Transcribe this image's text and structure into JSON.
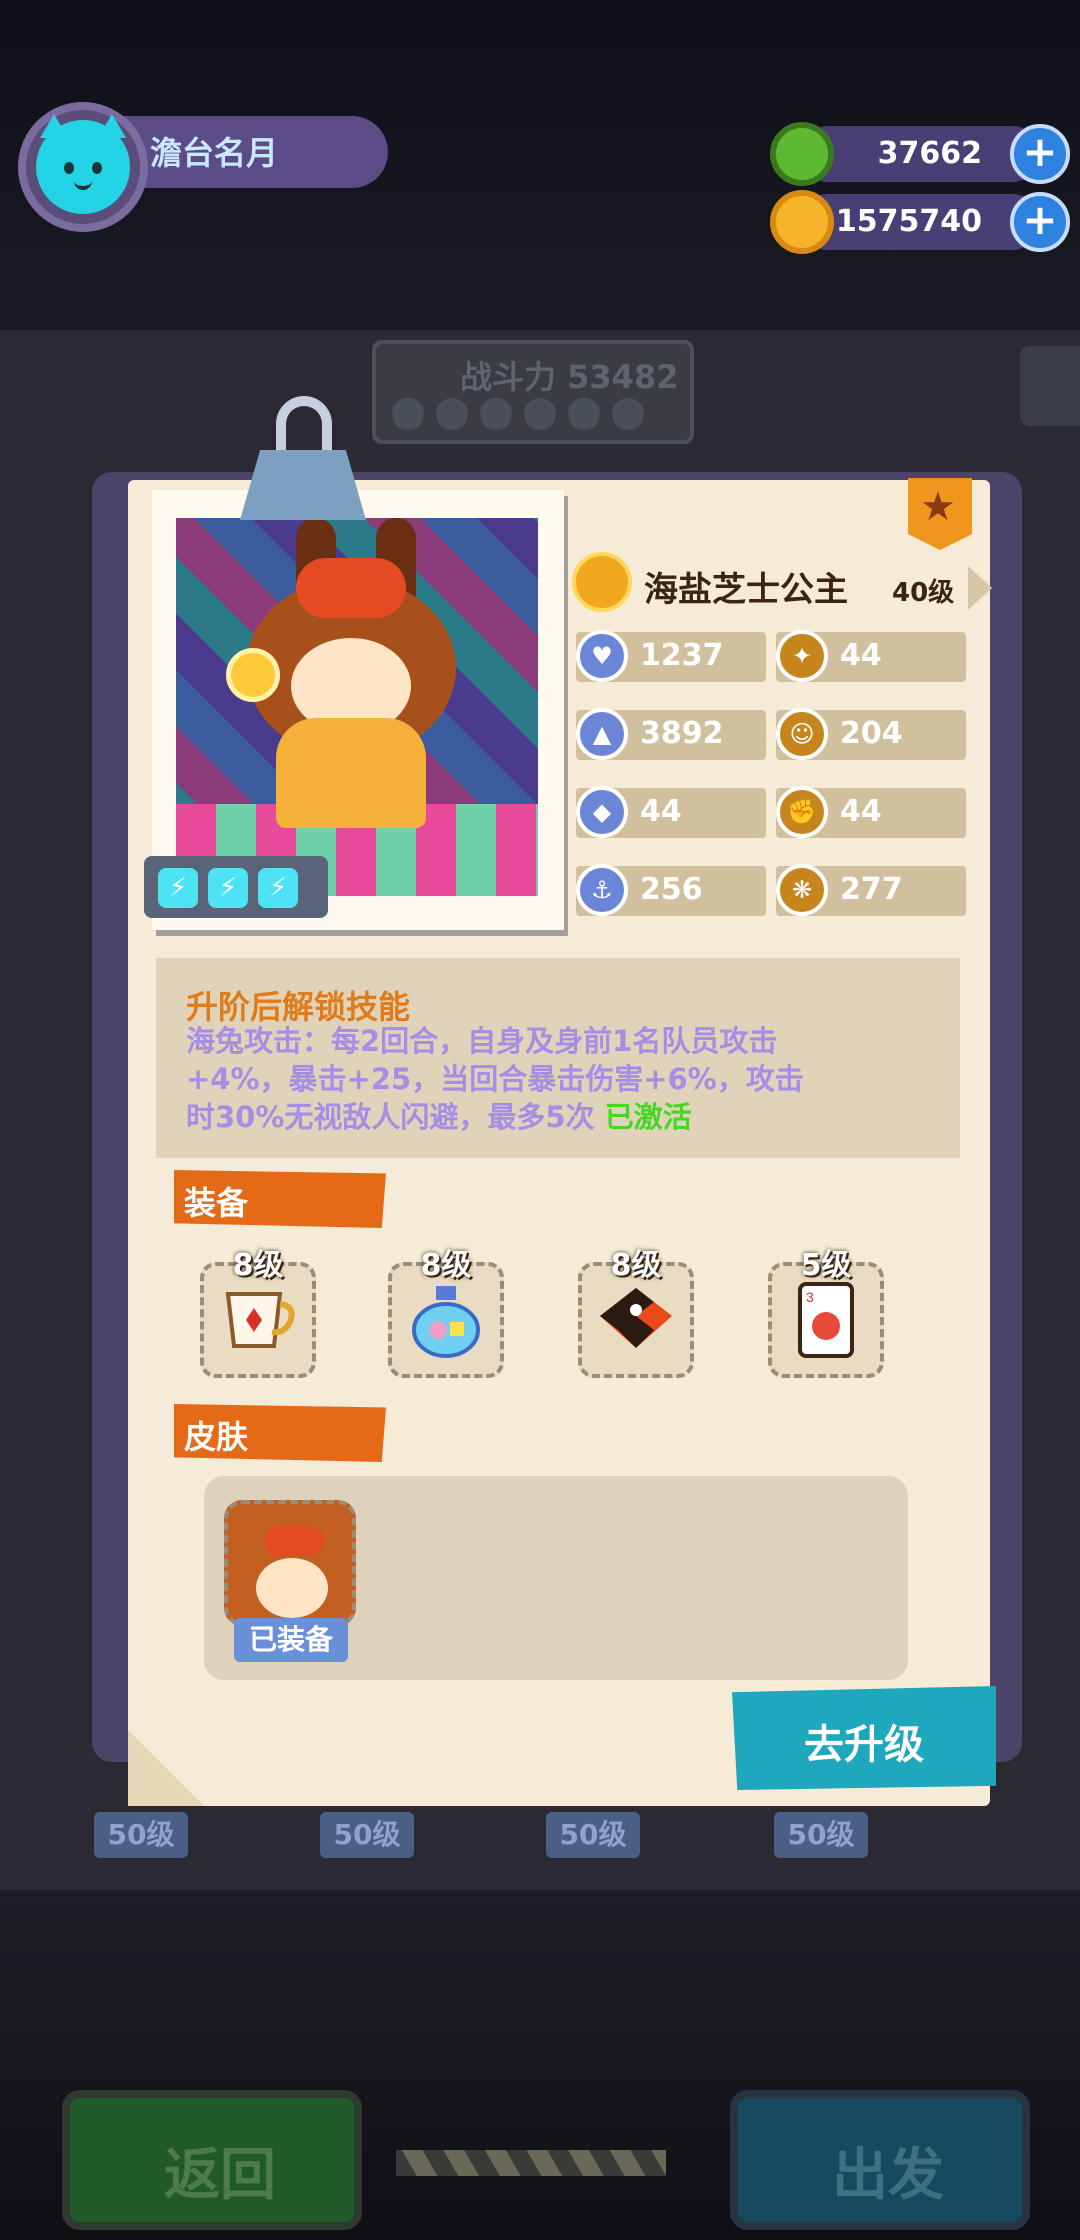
{
  "header": {
    "player_name": "澹台名月",
    "resources": [
      {
        "icon": "green-gem-coin-icon",
        "value": "37662"
      },
      {
        "icon": "gold-planet-coin-icon",
        "value": "1575740"
      }
    ],
    "plus_icon": "plus-icon"
  },
  "background": {
    "power_label": "战斗力 53482",
    "level_badges": [
      "50级",
      "50级",
      "50级",
      "50级"
    ]
  },
  "card": {
    "character_name": "海盐芝士公主",
    "level": "40级",
    "stats": [
      {
        "icon": "heart-shield-icon",
        "value": "1237"
      },
      {
        "icon": "crit-icon",
        "value": "44"
      },
      {
        "icon": "attack-icon",
        "value": "3892"
      },
      {
        "icon": "smile-icon",
        "value": "204"
      },
      {
        "icon": "defense-shield-icon",
        "value": "44"
      },
      {
        "icon": "muscle-icon",
        "value": "44"
      },
      {
        "icon": "anchor-icon",
        "value": "256"
      },
      {
        "icon": "dodge-icon",
        "value": "277"
      }
    ],
    "skill": {
      "title": "升阶后解锁技能",
      "description": "海兔攻击：每2回合，自身及身前1名队员攻击+4%，暴击+25，当回合暴击伤害+6%，攻击时30%无视敌人闪避，最多5次",
      "status": "已激活"
    },
    "equipment": {
      "title": "装备",
      "items": [
        {
          "icon": "teacup-icon",
          "level": "8级"
        },
        {
          "icon": "bottle-icon",
          "level": "8级"
        },
        {
          "icon": "checkerboard-icon",
          "level": "8级"
        },
        {
          "icon": "playing-card-icon",
          "level": "5级"
        }
      ]
    },
    "skin": {
      "title": "皮肤",
      "equipped_label": "已装备"
    },
    "upgrade_label": "去升级"
  },
  "bottom": {
    "back_label": "返回",
    "go_label": "出发"
  },
  "colors": {
    "card_bg": "#f5ebd6",
    "accent_orange": "#e46a18",
    "teal_button": "#1fa8bd",
    "skill_purple": "#a48ee6",
    "status_green": "#45d823"
  }
}
